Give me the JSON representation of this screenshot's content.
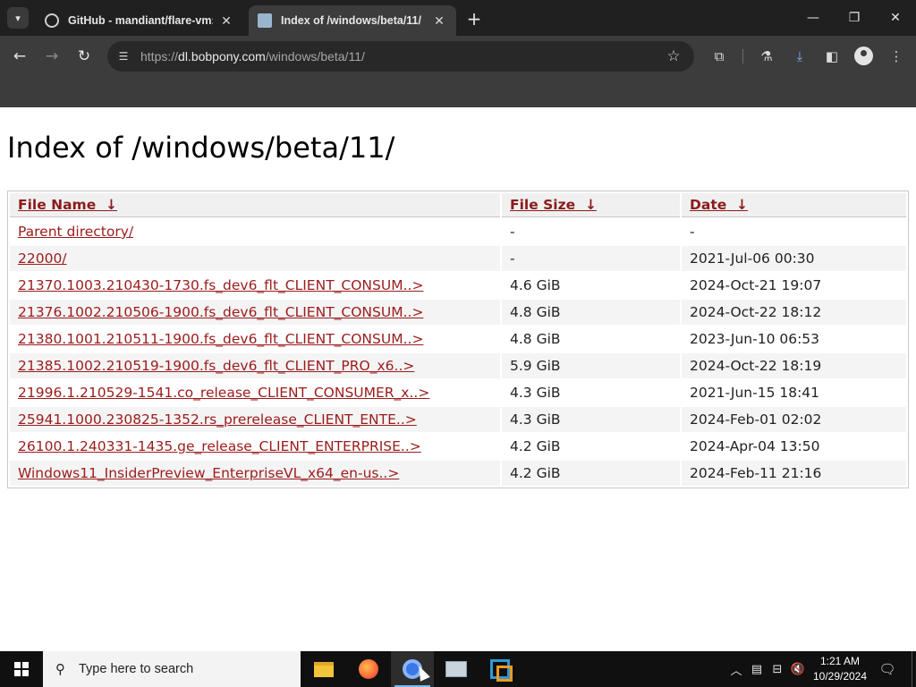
{
  "browser": {
    "tabs": [
      {
        "title": "GitHub - mandiant/flare-vm: A",
        "active": false,
        "icon": "github-icon"
      },
      {
        "title": "Index of /windows/beta/11/",
        "active": true,
        "icon": "document-icon"
      }
    ],
    "url_host": "dl.bobpony.com",
    "url_scheme": "https://",
    "url_path": "/windows/beta/11/"
  },
  "page": {
    "title": "Index of /windows/beta/11/",
    "columns": [
      {
        "label": "File Name",
        "sort_arrow": "↓"
      },
      {
        "label": "File Size",
        "sort_arrow": "↓"
      },
      {
        "label": "Date",
        "sort_arrow": "↓"
      }
    ],
    "rows": [
      {
        "name": "Parent directory/",
        "size": "-",
        "date": "-"
      },
      {
        "name": "22000/",
        "size": "-",
        "date": "2021-Jul-06 00:30"
      },
      {
        "name": "21370.1003.210430-1730.fs_dev6_flt_CLIENT_CONSUM..>",
        "size": "4.6 GiB",
        "date": "2024-Oct-21 19:07"
      },
      {
        "name": "21376.1002.210506-1900.fs_dev6_flt_CLIENT_CONSUM..>",
        "size": "4.8 GiB",
        "date": "2024-Oct-22 18:12"
      },
      {
        "name": "21380.1001.210511-1900.fs_dev6_flt_CLIENT_CONSUM..>",
        "size": "4.8 GiB",
        "date": "2023-Jun-10 06:53"
      },
      {
        "name": "21385.1002.210519-1900.fs_dev6_flt_CLIENT_PRO_x6..>",
        "size": "5.9 GiB",
        "date": "2024-Oct-22 18:19"
      },
      {
        "name": "21996.1.210529-1541.co_release_CLIENT_CONSUMER_x..>",
        "size": "4.3 GiB",
        "date": "2021-Jun-15 18:41"
      },
      {
        "name": "25941.1000.230825-1352.rs_prerelease_CLIENT_ENTE..>",
        "size": "4.3 GiB",
        "date": "2024-Feb-01 02:02"
      },
      {
        "name": "26100.1.240331-1435.ge_release_CLIENT_ENTERPRISE..>",
        "size": "4.2 GiB",
        "date": "2024-Apr-04 13:50"
      },
      {
        "name": "Windows11_InsiderPreview_EnterpriseVL_x64_en-us..>",
        "size": "4.2 GiB",
        "date": "2024-Feb-11 21:16"
      }
    ],
    "link_color": "#9b1b1b"
  },
  "taskbar": {
    "search_placeholder": "Type here to search",
    "time": "1:21 AM",
    "date": "10/29/2024",
    "pinned": [
      "file-explorer-icon",
      "firefox-icon",
      "chrome-icon",
      "server-manager-icon",
      "vmware-icon"
    ]
  }
}
